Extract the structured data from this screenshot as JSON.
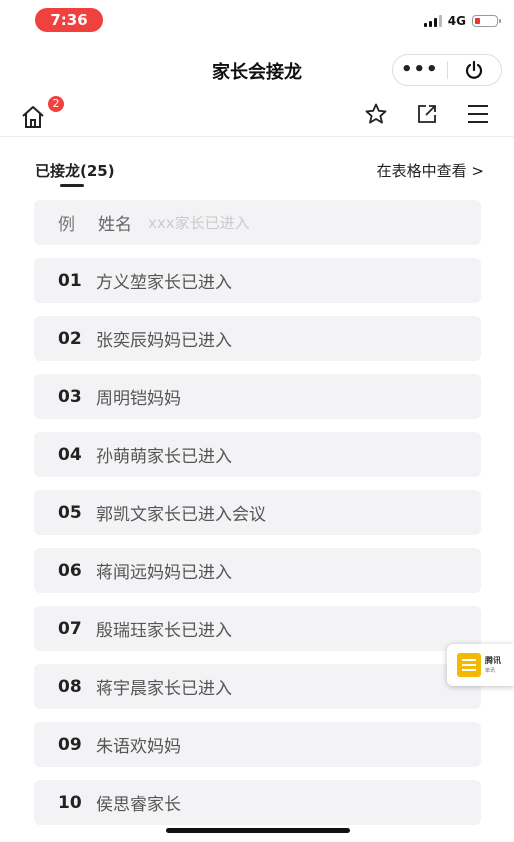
{
  "status_bar": {
    "time": "7:36",
    "network": "4G"
  },
  "header": {
    "title": "家长会接龙"
  },
  "toolbar": {
    "badge_count": "2"
  },
  "list": {
    "count_label": "已接龙(25)",
    "view_table_label": "在表格中查看 >",
    "example": {
      "prefix": "例",
      "field": "姓名",
      "placeholder": "xxx家长已进入"
    },
    "entries": [
      {
        "num": "01",
        "text": "方义堃家长已进入"
      },
      {
        "num": "02",
        "text": "张奕辰妈妈已进入"
      },
      {
        "num": "03",
        "text": "周明铠妈妈"
      },
      {
        "num": "04",
        "text": "孙萌萌家长已进入"
      },
      {
        "num": "05",
        "text": "郭凯文家长已进入会议"
      },
      {
        "num": "06",
        "text": "蒋闻远妈妈已进入"
      },
      {
        "num": "07",
        "text": "殷瑞珏家长已进入"
      },
      {
        "num": "08",
        "text": "蒋宇晨家长已进入"
      },
      {
        "num": "09",
        "text": "朱语欢妈妈"
      },
      {
        "num": "10",
        "text": "侯思睿家长"
      }
    ]
  },
  "floating_widget": {
    "line1": "腾讯",
    "line2": "单讯"
  },
  "colors": {
    "badge": "#f0413f",
    "row_bg": "#f3f3f5",
    "widget_icon": "#f5b800"
  }
}
